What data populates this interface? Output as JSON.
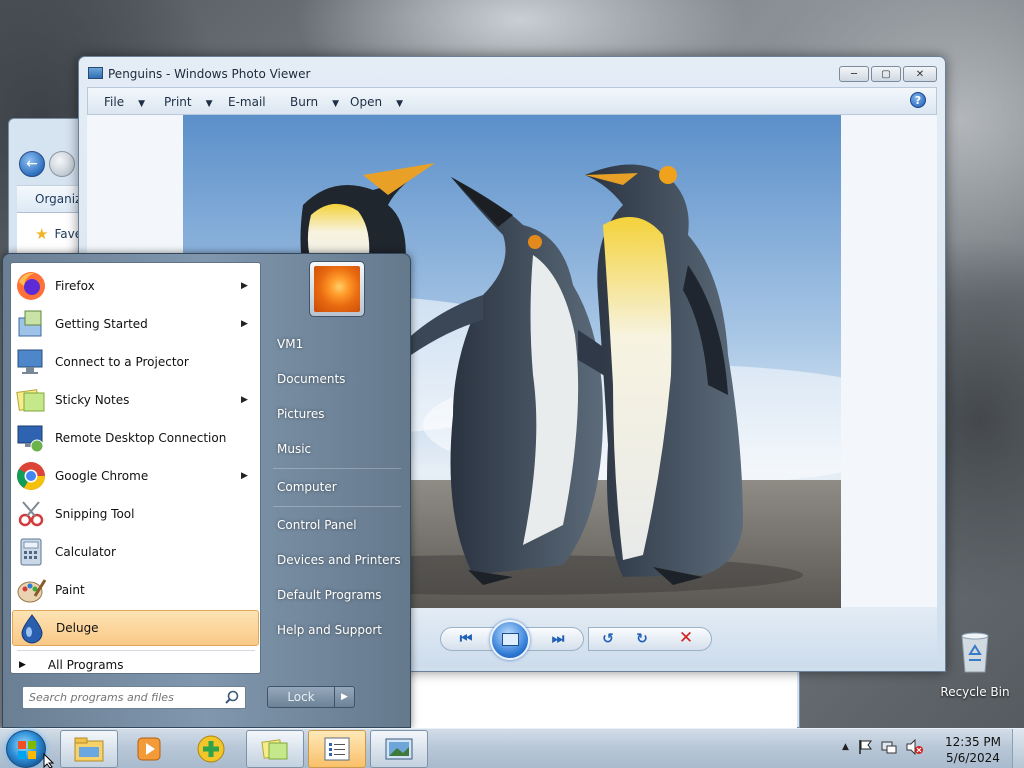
{
  "desktop": {
    "recycle_bin_label": "Recycle Bin"
  },
  "explorer": {
    "organize_label": "Organiz",
    "favorites_label": "Fave"
  },
  "photo_viewer": {
    "title": "Penguins - Windows Photo Viewer",
    "menu": {
      "file": "File",
      "print": "Print",
      "email": "E-mail",
      "burn": "Burn",
      "open": "Open"
    },
    "help_glyph": "?",
    "controls": [
      "previous",
      "slide-show",
      "next",
      "rotate-counterclockwise",
      "rotate-clockwise",
      "delete"
    ]
  },
  "start_menu": {
    "programs": [
      {
        "label": "Firefox",
        "icon": "firefox-icon",
        "has_submenu": true
      },
      {
        "label": "Getting Started",
        "icon": "getting-started-icon",
        "has_submenu": true
      },
      {
        "label": "Connect to a Projector",
        "icon": "projector-icon",
        "has_submenu": false
      },
      {
        "label": "Sticky Notes",
        "icon": "sticky-notes-icon",
        "has_submenu": true
      },
      {
        "label": "Remote Desktop Connection",
        "icon": "remote-desktop-icon",
        "has_submenu": false
      },
      {
        "label": "Google Chrome",
        "icon": "chrome-icon",
        "has_submenu": true
      },
      {
        "label": "Snipping Tool",
        "icon": "snipping-tool-icon",
        "has_submenu": false
      },
      {
        "label": "Calculator",
        "icon": "calculator-icon",
        "has_submenu": false
      },
      {
        "label": "Paint",
        "icon": "paint-icon",
        "has_submenu": false
      },
      {
        "label": "Deluge",
        "icon": "deluge-icon",
        "has_submenu": false,
        "selected": true
      }
    ],
    "all_programs": "All Programs",
    "search_placeholder": "Search programs and files",
    "right_items": [
      "VM1",
      "Documents",
      "Pictures",
      "Music",
      "Computer",
      "Control Panel",
      "Devices and Printers",
      "Default Programs",
      "Help and Support"
    ],
    "lock_label": "Lock"
  },
  "taskbar": {
    "items": [
      "windows-explorer",
      "media-player",
      "app-plus",
      "sticky-notes",
      "task-list",
      "photo-viewer"
    ],
    "time": "12:35 PM",
    "date": "5/6/2024"
  },
  "colors": {
    "selection": "#fac986",
    "accent": "#1f5fb5"
  }
}
